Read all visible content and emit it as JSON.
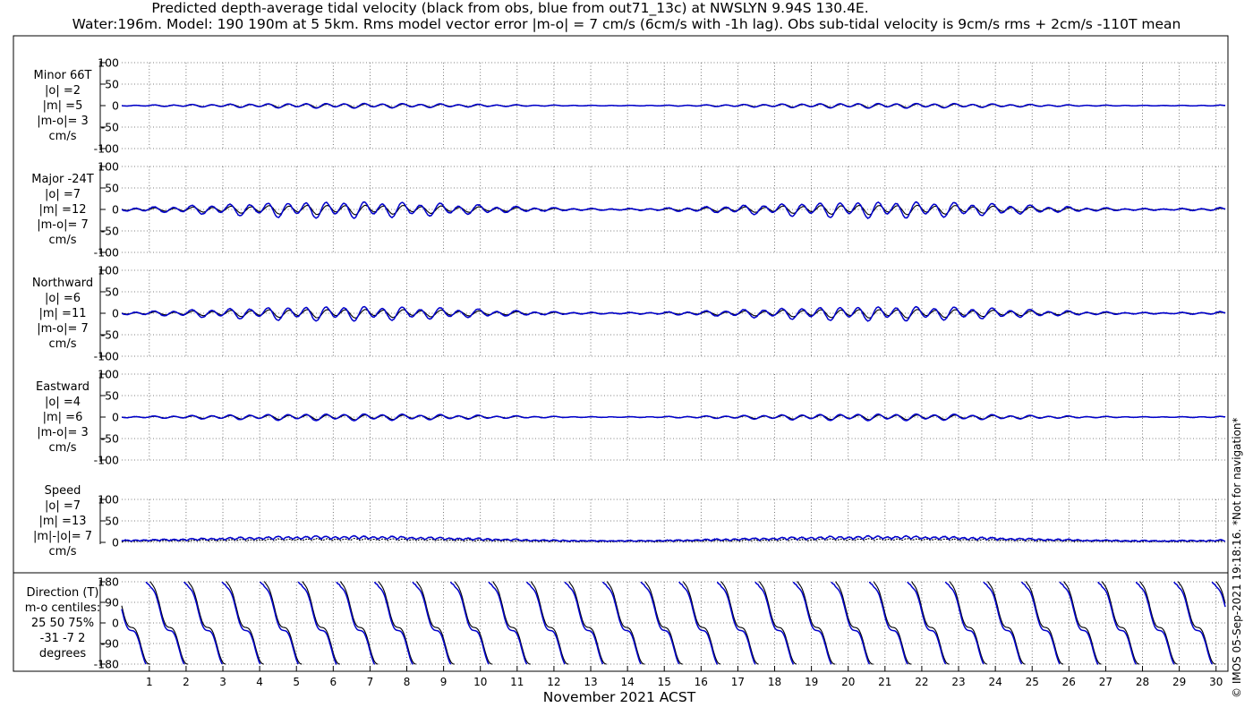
{
  "title": {
    "line1": "Predicted depth-average tidal velocity (black from obs, blue from out71_13c) at NWSLYN 9.94S 130.4E.",
    "line2": "Water:196m. Model: 190 190m at 5 5km. Rms model vector error |m-o| = 7 cm/s (6cm/s with -1h lag). Obs sub-tidal velocity is 9cm/s rms + 2cm/s -110T mean"
  },
  "copyright": "© IMOS 05-Sep-2021 19:18:16. *Not for navigation*",
  "colors": {
    "obs": "#000000",
    "model": "#0000cc",
    "grid": "#555555"
  },
  "chart_data": [
    {
      "type": "line",
      "panel": "minor",
      "labels": [
        "Minor 66T",
        "|o| =2",
        "|m| =5",
        "|m-o|= 3",
        "cm/s"
      ],
      "ylim": [
        -100,
        100
      ],
      "yticks": [
        "100",
        "50",
        "0",
        "-50",
        "-100"
      ],
      "grid": true,
      "series": [
        {
          "name": "obs",
          "amplitude": 4,
          "mean": 0,
          "kind": "velocity"
        },
        {
          "name": "model",
          "amplitude": 5,
          "mean": 0,
          "kind": "velocity"
        }
      ]
    },
    {
      "type": "line",
      "panel": "major",
      "labels": [
        "Major -24T",
        "|o| =7",
        "|m| =12",
        "|m-o|= 7",
        "cm/s"
      ],
      "ylim": [
        -100,
        100
      ],
      "yticks": [
        "100",
        "50",
        "0",
        "-50",
        "-100"
      ],
      "grid": true,
      "series": [
        {
          "name": "obs",
          "amplitude": 10,
          "mean": 0,
          "kind": "velocity"
        },
        {
          "name": "model",
          "amplitude": 17,
          "mean": 0,
          "kind": "velocity"
        }
      ]
    },
    {
      "type": "line",
      "panel": "northward",
      "labels": [
        "Northward",
        "|o| =6",
        "|m| =11",
        "|m-o|= 7",
        "cm/s"
      ],
      "ylim": [
        -100,
        100
      ],
      "yticks": [
        "100",
        "50",
        "0",
        "-50",
        "-100"
      ],
      "grid": true,
      "series": [
        {
          "name": "obs",
          "amplitude": 9,
          "mean": 0,
          "kind": "velocity"
        },
        {
          "name": "model",
          "amplitude": 15,
          "mean": 0,
          "kind": "velocity"
        }
      ]
    },
    {
      "type": "line",
      "panel": "eastward",
      "labels": [
        "Eastward",
        "|o| =4",
        "|m| =6",
        "|m-o|= 3",
        "cm/s"
      ],
      "ylim": [
        -100,
        100
      ],
      "yticks": [
        "100",
        "50",
        "0",
        "-50",
        "-100"
      ],
      "grid": true,
      "series": [
        {
          "name": "obs",
          "amplitude": 5,
          "mean": 0,
          "kind": "velocity"
        },
        {
          "name": "model",
          "amplitude": 7,
          "mean": 0,
          "kind": "velocity"
        }
      ]
    },
    {
      "type": "line",
      "panel": "speed",
      "labels": [
        "Speed",
        "|o| =7",
        "|m| =13",
        "|m|-|o|= 7",
        "cm/s"
      ],
      "ylim": [
        0,
        100
      ],
      "yticks": [
        "100",
        "50",
        "0"
      ],
      "grid": true,
      "series": [
        {
          "name": "obs",
          "amplitude": 7,
          "mean": 7,
          "kind": "speed"
        },
        {
          "name": "model",
          "amplitude": 12,
          "mean": 12,
          "kind": "speed"
        }
      ]
    },
    {
      "type": "line",
      "panel": "direction",
      "labels": [
        "Direction (T)",
        "m-o centiles:",
        "25  50  75%",
        "-31  -7   2",
        "degrees"
      ],
      "ylim": [
        -180,
        180
      ],
      "yticks": [
        "180",
        "90",
        "0",
        "-90",
        "-180"
      ],
      "grid": true,
      "series": [
        {
          "name": "obs",
          "kind": "direction"
        },
        {
          "name": "model",
          "kind": "direction"
        }
      ]
    }
  ],
  "x_axis": {
    "label": "November 2021 ACST",
    "ticks": [
      "1",
      "2",
      "3",
      "4",
      "5",
      "6",
      "7",
      "8",
      "9",
      "10",
      "11",
      "12",
      "13",
      "14",
      "15",
      "16",
      "17",
      "18",
      "19",
      "20",
      "21",
      "22",
      "23",
      "24",
      "25",
      "26",
      "27",
      "28",
      "29",
      "30"
    ],
    "xlim_days": [
      0.25,
      30.25
    ]
  }
}
